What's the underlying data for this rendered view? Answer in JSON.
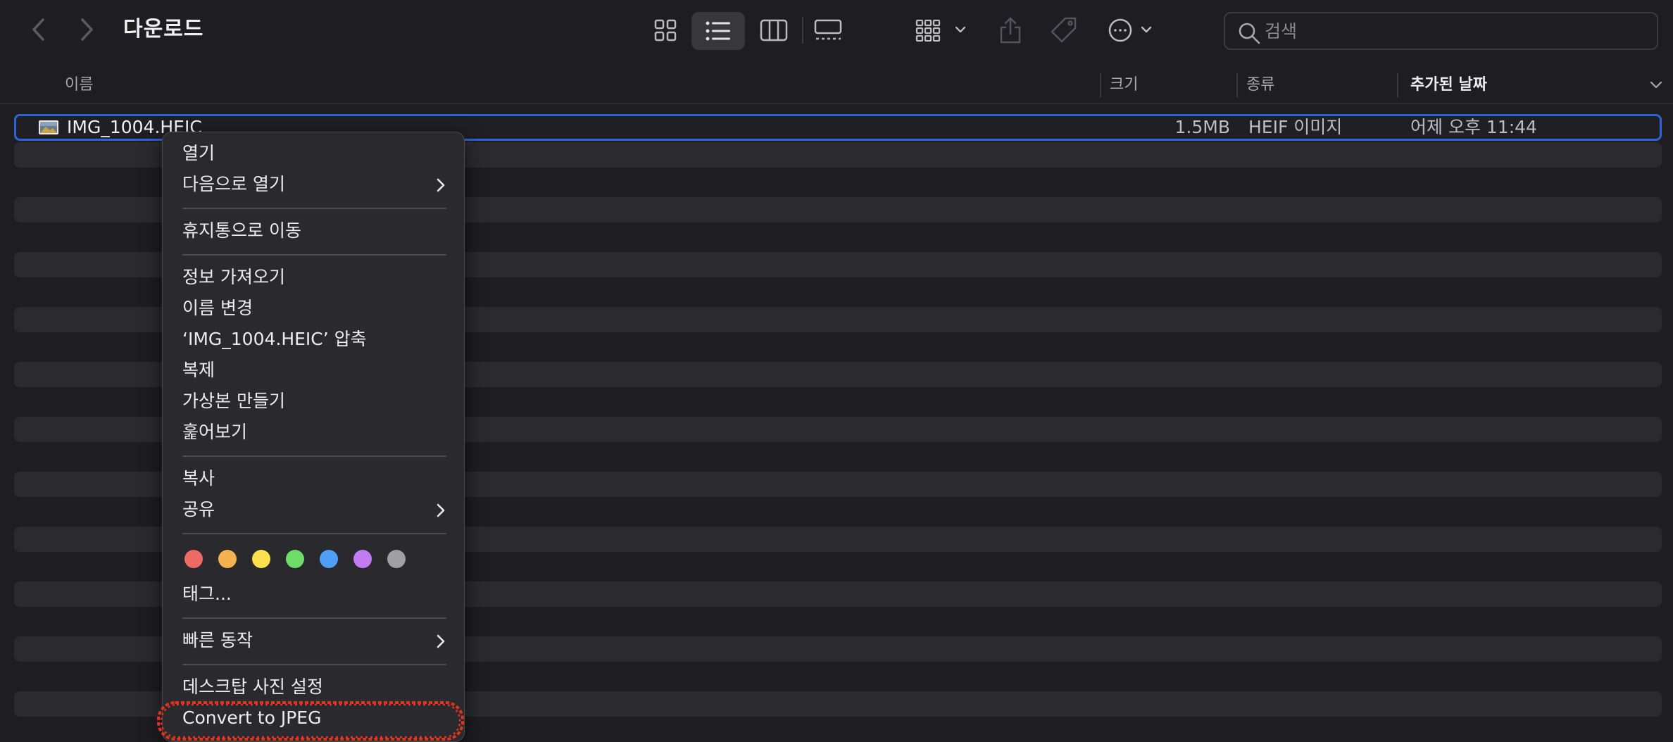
{
  "toolbar": {
    "title": "다운로드",
    "search_placeholder": "검색"
  },
  "columns": {
    "name": "이름",
    "size": "크기",
    "kind": "종류",
    "date_added": "추가된 날짜"
  },
  "file": {
    "name": "IMG_1004.HEIC",
    "size": "1.5MB",
    "kind": "HEIF 이미지",
    "date_added": "어제 오후 11:44"
  },
  "context_menu": {
    "open": "열기",
    "open_with": "다음으로 열기",
    "move_to_trash": "휴지통으로 이동",
    "get_info": "정보 가져오기",
    "rename": "이름 변경",
    "compress": "‘IMG_1004.HEIC’ 압축",
    "duplicate": "복제",
    "make_alias": "가상본 만들기",
    "quick_look": "훑어보기",
    "copy": "복사",
    "share": "공유",
    "tags": "태그...",
    "quick_actions": "빠른 동작",
    "set_desktop_picture": "데스크탑 사진 설정",
    "convert_to_jpeg": "Convert to JPEG"
  },
  "tag_colors": [
    "#ee6a64",
    "#f5b34f",
    "#fce04d",
    "#6fdc6a",
    "#4f9ff5",
    "#c27cf2",
    "#9f9fa4"
  ],
  "highlight_color": "#e0341e",
  "selection_color": "#2e63d6"
}
